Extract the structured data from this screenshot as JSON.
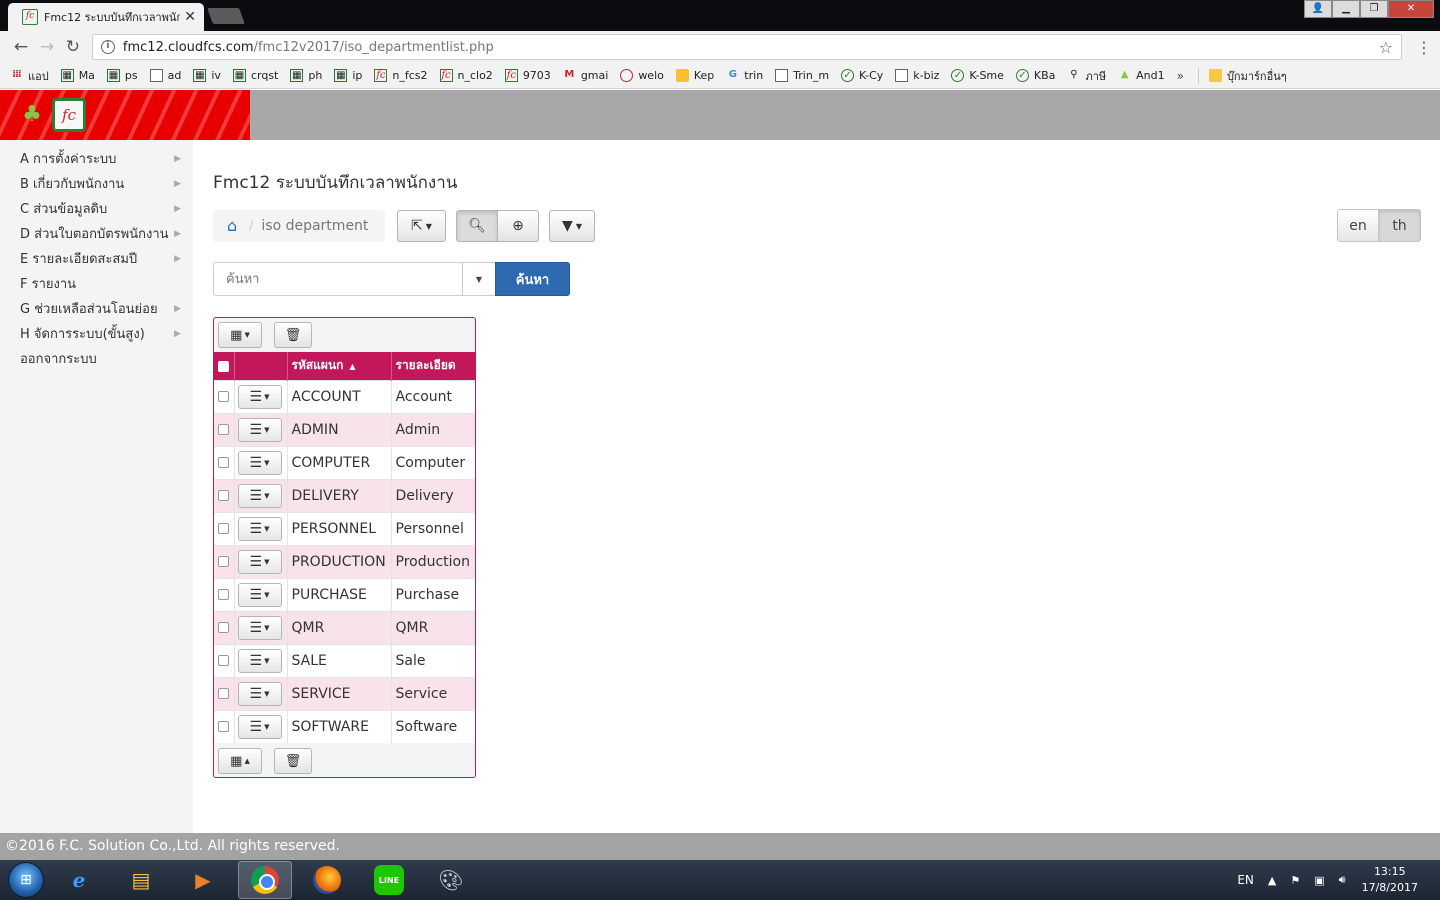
{
  "browser": {
    "tab_title": "Fmc12 ระบบบันทึกเวลาพนักงาน",
    "tab_favicon_text": "fc",
    "url_host": "fmc12.cloudfcs.com",
    "url_path": "/fmc12v2017/iso_departmentlist.php",
    "bookmarks": [
      {
        "label": "แอป",
        "icon": "apps-icon"
      },
      {
        "label": "Ma",
        "icon": "sheet-icon"
      },
      {
        "label": "ps",
        "icon": "sheet-icon"
      },
      {
        "label": "ad",
        "icon": "doc-icon"
      },
      {
        "label": "iv",
        "icon": "sheet-icon"
      },
      {
        "label": "crqst",
        "icon": "sheet-icon"
      },
      {
        "label": "ph",
        "icon": "sheet-icon"
      },
      {
        "label": "ip",
        "icon": "sheet-icon"
      },
      {
        "label": "n_fcs2",
        "icon": "fc-icon"
      },
      {
        "label": "n_clo2",
        "icon": "fc-icon"
      },
      {
        "label": "9703",
        "icon": "fc-icon"
      },
      {
        "label": "gmai",
        "icon": "gmail-icon"
      },
      {
        "label": "welo",
        "icon": "generic-icon"
      },
      {
        "label": "Kep",
        "icon": "keep-icon"
      },
      {
        "label": "trin",
        "icon": "google-icon"
      },
      {
        "label": "Trin_m",
        "icon": "doc-icon"
      },
      {
        "label": "K-Cy",
        "icon": "kbank-icon"
      },
      {
        "label": "k-biz",
        "icon": "doc-icon"
      },
      {
        "label": "K-Sme",
        "icon": "kbank-icon"
      },
      {
        "label": "KBa",
        "icon": "kbank-icon"
      },
      {
        "label": "ภาษี",
        "icon": "link-icon"
      },
      {
        "label": "And1",
        "icon": "android-icon"
      }
    ],
    "bookmarks_more": "»",
    "other_bookmarks": "บุ๊กมาร์กอื่นๆ"
  },
  "sidebar": {
    "items": [
      {
        "label": "A การตั้งค่าระบบ",
        "has_sub": true
      },
      {
        "label": "B เกี่ยวกับพนักงาน",
        "has_sub": true
      },
      {
        "label": "C ส่วนข้อมูลดิบ",
        "has_sub": true
      },
      {
        "label": "D ส่วนใบตอกบัตรพนักงาน",
        "has_sub": true
      },
      {
        "label": "E รายละเอียดสะสมปี",
        "has_sub": true
      },
      {
        "label": "F รายงาน",
        "has_sub": false
      },
      {
        "label": "G ช่วยเหลือส่วนโอนย่อย",
        "has_sub": true
      },
      {
        "label": "H จัดการระบบ(ขั้นสูง)",
        "has_sub": true
      },
      {
        "label": "ออกจากระบบ",
        "has_sub": false
      }
    ]
  },
  "page": {
    "title": "Fmc12 ระบบบันทึกเวลาพนักงาน",
    "breadcrumb": "iso department"
  },
  "lang": {
    "en": "en",
    "th": "th",
    "active": "th"
  },
  "search": {
    "placeholder": "ค้นหา",
    "button": "ค้นหา"
  },
  "grid": {
    "columns": [
      "รหัสแผนก",
      "รายละเอียด"
    ],
    "sorted_column": "รหัสแผนก",
    "sort_dir": "asc",
    "rows": [
      {
        "code": "ACCOUNT",
        "desc": "Account"
      },
      {
        "code": "ADMIN",
        "desc": "Admin"
      },
      {
        "code": "COMPUTER",
        "desc": "Computer"
      },
      {
        "code": "DELIVERY",
        "desc": "Delivery"
      },
      {
        "code": "PERSONNEL",
        "desc": "Personnel"
      },
      {
        "code": "PRODUCTION",
        "desc": "Production"
      },
      {
        "code": "PURCHASE",
        "desc": "Purchase"
      },
      {
        "code": "QMR",
        "desc": "QMR"
      },
      {
        "code": "SALE",
        "desc": "Sale"
      },
      {
        "code": "SERVICE",
        "desc": "Service"
      },
      {
        "code": "SOFTWARE",
        "desc": "Software"
      }
    ]
  },
  "footer": {
    "text": "©2016 F.C. Solution Co.,Ltd. All rights reserved."
  },
  "taskbar": {
    "apps": [
      "internet-explorer-icon",
      "file-explorer-icon",
      "media-player-icon",
      "chrome-icon",
      "firefox-icon",
      "line-icon",
      "paint-icon"
    ],
    "line_text": "LINE",
    "active_app": "chrome-icon",
    "lang_indicator": "EN",
    "time": "13:15",
    "date": "17/8/2017"
  },
  "colors": {
    "grid_header": "#c2185b",
    "search_button": "#2d6ab0",
    "brand_red": "#e80000",
    "header_gray": "#a8a8a8"
  }
}
